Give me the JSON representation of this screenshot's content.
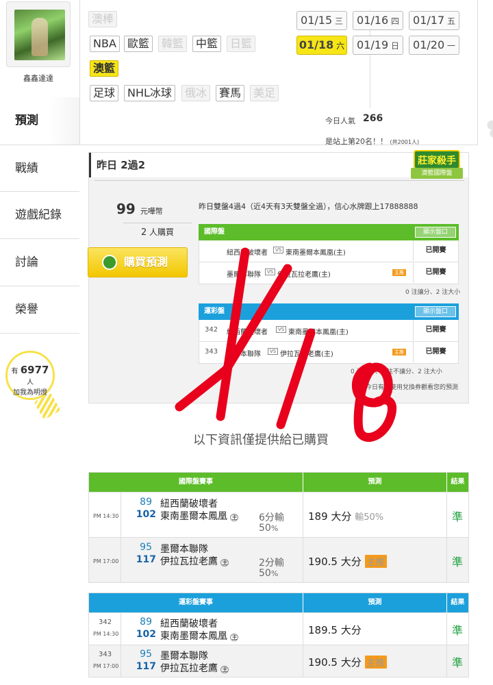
{
  "user": {
    "name": "鑫鑫達達"
  },
  "nav": [
    {
      "label": "預測",
      "active": true
    },
    {
      "label": "戰績"
    },
    {
      "label": "遊戲紀錄"
    },
    {
      "label": "討論"
    },
    {
      "label": "榮譽"
    }
  ],
  "bulb": {
    "prefix": "有",
    "count": "6977",
    "suffix": "人",
    "line2": "加我為明燈"
  },
  "sports": {
    "row1": [
      "澳棒"
    ],
    "row2": [
      "NBA",
      "歐籃",
      "韓籃",
      "中籃",
      "日籃"
    ],
    "row3": [
      "澳籃"
    ],
    "row4": [
      "足球",
      "NHL冰球",
      "俄冰",
      "賽馬",
      "美足"
    ]
  },
  "dates": [
    {
      "date": "01/15",
      "day": "三"
    },
    {
      "date": "01/16",
      "day": "四"
    },
    {
      "date": "01/17",
      "day": "五"
    },
    {
      "date": "01/18",
      "day": "六",
      "active": true
    },
    {
      "date": "01/19",
      "day": "日"
    },
    {
      "date": "01/20",
      "day": "一"
    }
  ],
  "popularity": {
    "label": "今日人氣",
    "value": "266",
    "rank_text": "是站上第20名！！",
    "rank_total": "(共2001人)"
  },
  "yesterday": {
    "title": "昨日 2過2",
    "badge_top": "莊家殺手",
    "badge_bottom": "澳籃國際盤",
    "price": "99",
    "price_unit": "元嘩幣",
    "buyers": "2",
    "buyers_label": "人購買",
    "buy_button": "購買預測",
    "info": "昨日雙盤4過4（近4天有3天雙盤全過），信心水牌跟上17888888",
    "intl": {
      "title": "國際盤",
      "show_btn": "顯示盤口",
      "rows": [
        {
          "num": "",
          "away": "紐西蘭破壞者",
          "home": "東南墨爾本鳳凰(主)",
          "status": "已開賽",
          "host": false
        },
        {
          "num": "",
          "away": "墨爾本聯隊",
          "home": "伊拉瓦拉老鷹(主)",
          "status": "已開賽",
          "host": true
        }
      ],
      "note": "0 注讓分、2 注大小"
    },
    "lottery": {
      "title": "運彩盤",
      "show_btn": "顯示盤口",
      "rows": [
        {
          "num": "342",
          "away": "紐西蘭破壞者",
          "home": "東南墨爾本鳳凰(主)",
          "status": "已開賽",
          "host": false
        },
        {
          "num": "343",
          "away": "墨爾本聯隊",
          "home": "伊拉瓦拉老鷹(主)",
          "status": "已開賽",
          "host": true
        }
      ],
      "note": "0 注讓分、0 注不讓分、2 注大小",
      "note2": "今日有…使用兌換券觀看您的預測"
    }
  },
  "info_message": "以下資訊僅提供給已購買",
  "host_badge": "主推",
  "intl_results": {
    "headers": [
      "國際盤賽事",
      "預測",
      "結果"
    ],
    "rows": [
      {
        "time": "PM 14:30",
        "away_score": "89",
        "away": "紐西蘭破壞者",
        "home_score": "102",
        "home": "東南墨爾本鳳凰",
        "handi": "6分輸",
        "handi_pct": "50",
        "pick": "189 大分",
        "pick_extra": "輸50%",
        "result": "準",
        "host": false
      },
      {
        "time": "PM 17:00",
        "away_score": "95",
        "away": "墨爾本聯隊",
        "home_score": "117",
        "home": "伊拉瓦拉老鷹",
        "handi": "2分輸",
        "handi_pct": "50",
        "pick": "190.5 大分",
        "pick_extra": "",
        "result": "準",
        "host": true
      }
    ]
  },
  "lottery_results": {
    "headers": [
      "運彩盤賽事",
      "預測",
      "結果"
    ],
    "rows": [
      {
        "num": "342",
        "time": "PM 14:30",
        "away_score": "89",
        "away": "紐西蘭破壞者",
        "home_score": "102",
        "home": "東南墨爾本鳳凰",
        "pick": "189.5 大分",
        "result": "準",
        "host": false
      },
      {
        "num": "343",
        "time": "PM 17:00",
        "away_score": "95",
        "away": "墨爾本聯隊",
        "home_score": "117",
        "home": "伊拉瓦拉老鷹",
        "pick": "190.5 大分",
        "result": "準",
        "host": true
      }
    ]
  },
  "handwriting": "1/18",
  "colors": {
    "accent_yellow": "#f7e617",
    "green": "#5cbc2a",
    "blue": "#1ca0dc",
    "ink_red": "#e8001c"
  }
}
